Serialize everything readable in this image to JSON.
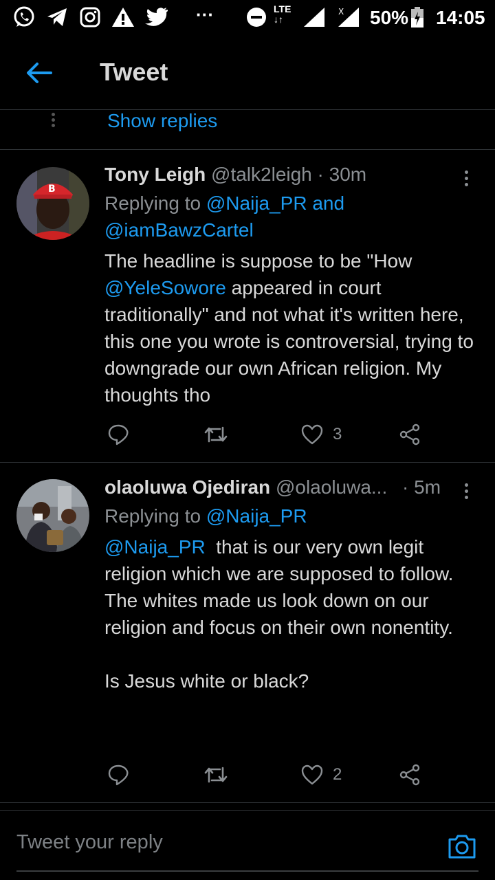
{
  "status_bar": {
    "icons": [
      "whatsapp-icon",
      "telegram-icon",
      "instagram-icon",
      "alert-icon",
      "twitter-icon",
      "more-notifications-icon",
      "dnd-icon",
      "lte-signal-icon",
      "signal-icon",
      "battery-icon"
    ],
    "network": "LTE",
    "battery": "50%",
    "time": "14:05"
  },
  "header": {
    "title": "Tweet",
    "back_icon": "back-arrow-icon"
  },
  "show_replies": "Show replies",
  "tweets": [
    {
      "name": "Tony Leigh",
      "handle": "@talk2leigh",
      "time": "· 30m",
      "replying_prefix": "Replying to",
      "replying_to_1": "@Naija_PR and",
      "replying_to_2": "@iamBawzCartel",
      "body_1": "The headline is suppose to be \"How",
      "mention": "@YeleSowore",
      "body_2": " appeared in court traditionally\" and not what it's written here, this one you wrote is controversial, trying to downgrade our own African religion. My thoughts tho",
      "likes": "3"
    },
    {
      "name": "olaoluwa Ojediran",
      "handle": "@olaoluwa...",
      "time": "· 5m",
      "replying_prefix": "Replying to",
      "replying_to_1": "@Naija_PR",
      "mention": "@Naija_PR",
      "body_1": "  that is our very own legit religion which we are supposed to follow.",
      "body_2": "The whites made us look down on our religion and focus on their own nonentity.",
      "body_3": "Is Jesus white or black?",
      "likes": "2"
    }
  ],
  "compose": {
    "placeholder": "Tweet your reply",
    "camera_icon": "camera-icon"
  },
  "colors": {
    "background": "#000000",
    "accent": "#1d9bf0",
    "text": "#d9d9d9",
    "muted": "#8b8f93",
    "divider": "#2f3336"
  }
}
